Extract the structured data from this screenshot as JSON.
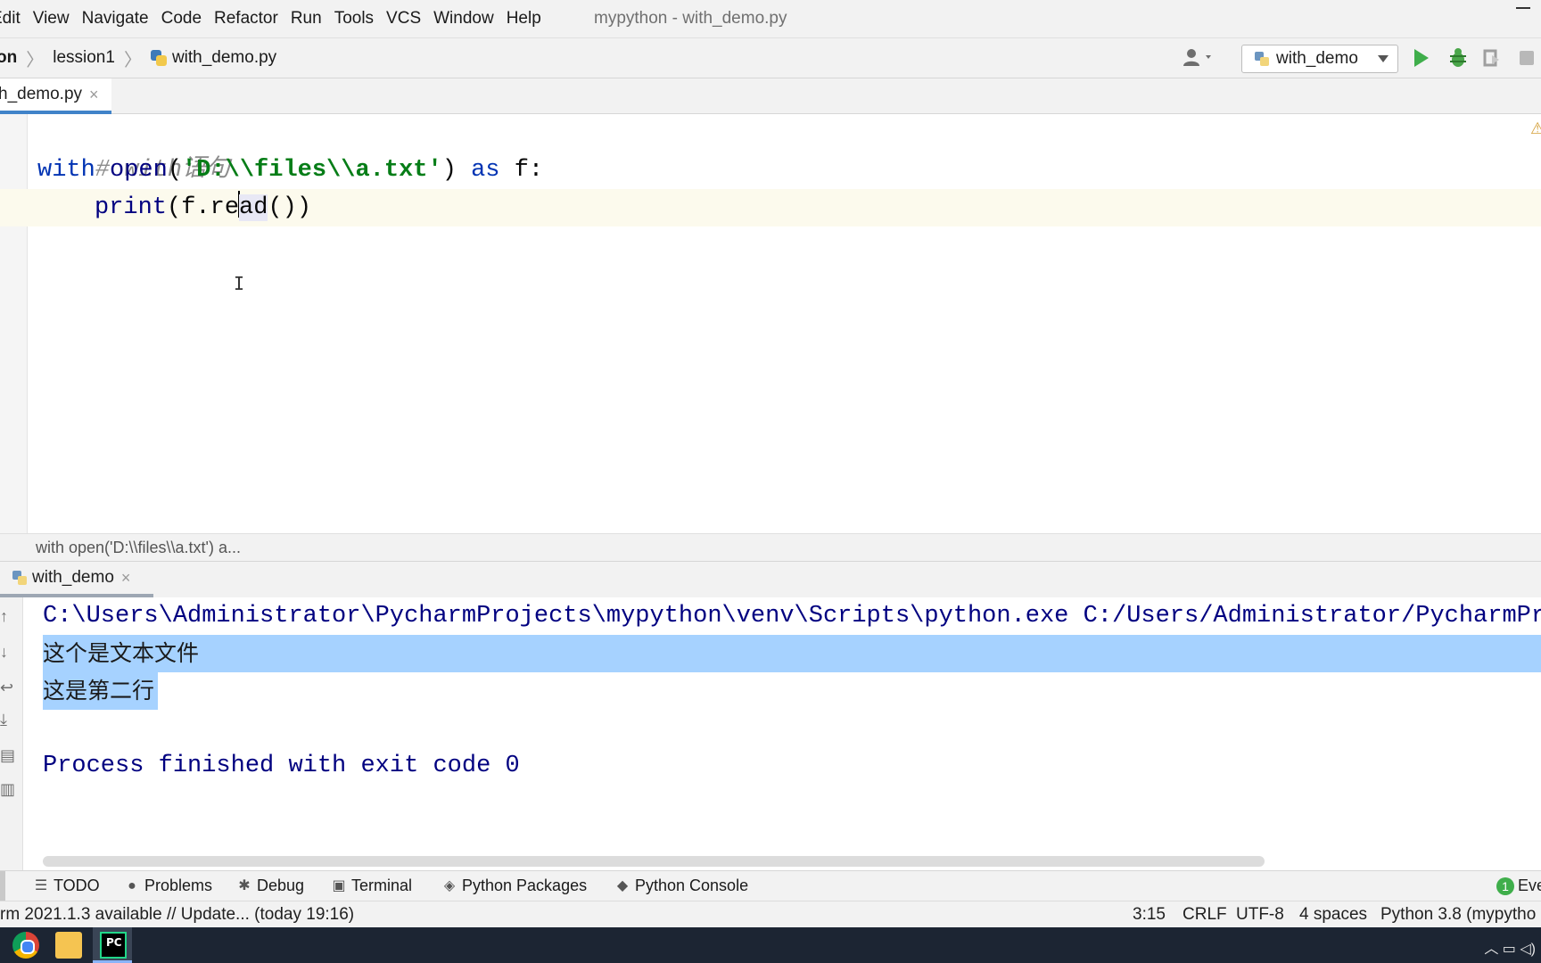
{
  "menu": {
    "items": [
      "Edit",
      "View",
      "Navigate",
      "Code",
      "Refactor",
      "Run",
      "Tools",
      "VCS",
      "Window",
      "Help"
    ],
    "window_title": "mypython - with_demo.py"
  },
  "navbar": {
    "project_partial": "on",
    "folder": "lession1",
    "file": "with_demo.py",
    "run_config": "with_demo"
  },
  "editor_tab": {
    "label": "h_demo.py",
    "close": "×"
  },
  "code": {
    "line1_comment": "# with语句",
    "line2": {
      "kw_with": "with",
      "fn_open": "open",
      "paren_open": "(",
      "string": "'D:\\\\files\\\\a.txt'",
      "paren_close": ")",
      "kw_as": "as",
      "var": "f:"
    },
    "line3": {
      "fn_print": "print",
      "before_cursor": "(f.re",
      "after_cursor": "ad",
      "tail": "())"
    }
  },
  "structure_bar": {
    "label": "with open('D:\\\\files\\\\a.txt') a..."
  },
  "run_tab": {
    "label": "with_demo",
    "close": "×"
  },
  "console": {
    "command": "C:\\Users\\Administrator\\PycharmProjects\\mypython\\venv\\Scripts\\python.exe C:/Users/Administrator/PycharmPro",
    "output_line1": "这个是文本文件",
    "output_line2": "这是第二行",
    "exit_message": "Process finished with exit code 0"
  },
  "tool_windows": {
    "todo": "TODO",
    "problems": "Problems",
    "debug": "Debug",
    "terminal": "Terminal",
    "python_packages": "Python Packages",
    "python_console": "Python Console",
    "event_count": "1",
    "event_label": "Eve"
  },
  "status": {
    "message": "rm 2021.1.3 available // Update... (today 19:16)",
    "position": "3:15",
    "line_sep": "CRLF",
    "encoding": "UTF-8",
    "indent": "4 spaces",
    "interpreter": "Python 3.8 (mypytho"
  },
  "colors": {
    "accent": "#4083c9",
    "run_green": "#3fae4b",
    "selection": "#a6d2ff",
    "keyword": "#0033b3",
    "string": "#067d17",
    "comment": "#8c8c8c"
  }
}
